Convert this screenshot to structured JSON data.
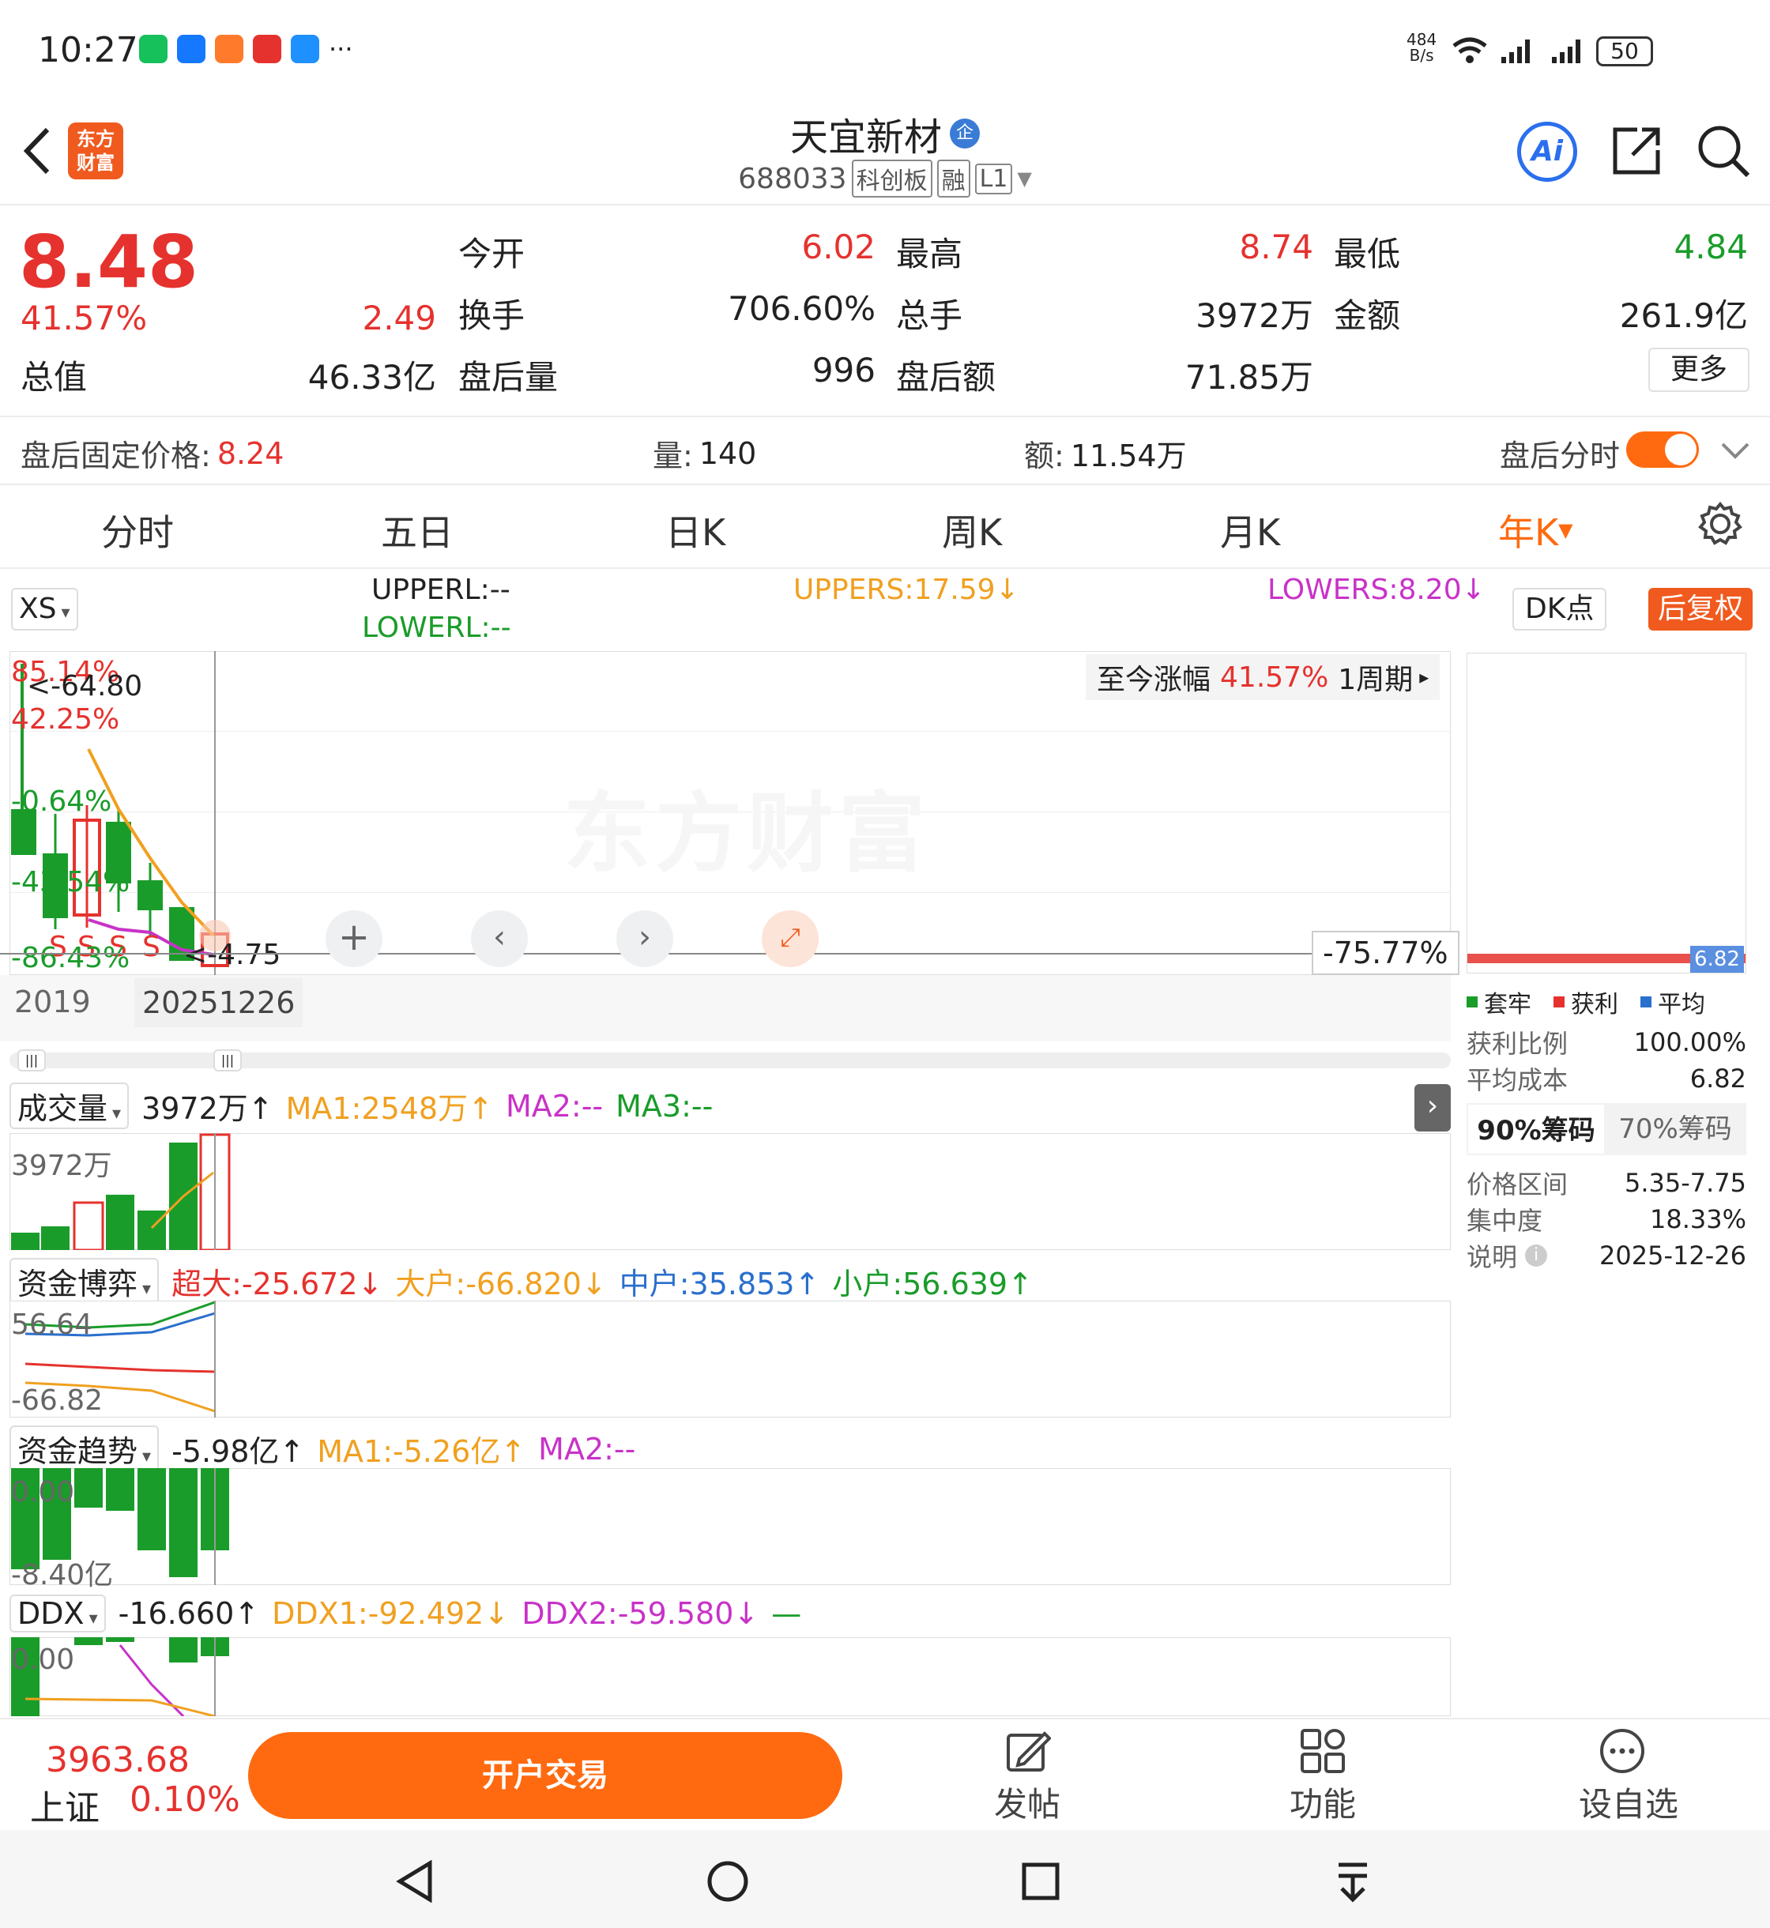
{
  "status": {
    "time": "10:27",
    "net_speed_value": "484",
    "net_speed_unit": "B/s",
    "battery": "50"
  },
  "header": {
    "name": "天宜新材",
    "enterprise_badge": "企",
    "code": "688033",
    "tags": [
      "科创板",
      "融",
      "L1"
    ],
    "brand_line1": "东方",
    "brand_line2": "财富",
    "ai_label": "Ai"
  },
  "quote": {
    "price": "8.48",
    "change_pct": "41.57%",
    "change_abs": "2.49",
    "open_label": "今开",
    "open": "6.02",
    "high_label": "最高",
    "high": "8.74",
    "low_label": "最低",
    "low": "4.84",
    "turnover_label": "换手",
    "turnover": "706.60%",
    "volume_label": "总手",
    "volume": "3972万",
    "amount_label": "金额",
    "amount": "261.9亿",
    "mktcap_label": "总值",
    "mktcap": "46.33亿",
    "after_vol_label": "盘后量",
    "after_vol": "996",
    "after_amt_label": "盘后额",
    "after_amt": "71.85万",
    "more": "更多"
  },
  "after_hours": {
    "price_label": "盘后固定价格:",
    "price": "8.24",
    "vol_label": "量:",
    "vol": "140",
    "amt_label": "额:",
    "amt": "11.54万",
    "toggle_label": "盘后分时"
  },
  "tabs": [
    "分时",
    "五日",
    "日K",
    "周K",
    "月K",
    "年K"
  ],
  "indicator": {
    "name": "XS",
    "upperl": "UPPERL:--",
    "lowerl": "LOWERL:--",
    "uppers": "UPPERS:17.59↓",
    "lowers": "LOWERS:8.20↓",
    "dk": "DK点",
    "fq": "后复权"
  },
  "chart": {
    "range_label": "至今涨幅",
    "range_value": "41.57%",
    "period": "1周期",
    "y_labels": [
      "85.14%",
      "42.25%",
      "-0.64%",
      "-43.54%",
      "-86.43%"
    ],
    "hi_marker": "<-64.80",
    "lo_marker": "<-4.75",
    "cross_value": "-75.77%",
    "x_start": "2019",
    "x_end": "20251226",
    "watermark": "东方财富"
  },
  "chip": {
    "avg_tag": "6.82",
    "legend": [
      "套牢",
      "获利",
      "平均"
    ],
    "rows": [
      {
        "k": "获利比例",
        "v": "100.00%"
      },
      {
        "k": "平均成本",
        "v": "6.82"
      }
    ],
    "tab_a": "90%筹码",
    "tab_b": "70%筹码",
    "rows2": [
      {
        "k": "价格区间",
        "v": "5.35-7.75"
      },
      {
        "k": "集中度",
        "v": "18.33%"
      },
      {
        "k": "说明",
        "v": "2025-12-26"
      }
    ]
  },
  "volume_panel": {
    "name": "成交量",
    "value": "3972万↑",
    "ma1": "MA1:2548万↑",
    "ma2": "MA2:--",
    "ma3": "MA3:--",
    "label": "3972万"
  },
  "fund_game": {
    "name": "资金博弈",
    "super": "超大:-25.672↓",
    "big": "大户:-66.820↓",
    "mid": "中户:35.853↑",
    "small": "小户:56.639↑",
    "top": "56.64",
    "bottom": "-66.82"
  },
  "fund_trend": {
    "name": "资金趋势",
    "value": "-5.98亿↑",
    "ma1": "MA1:-5.26亿↑",
    "ma2": "MA2:--",
    "top": "0.00",
    "bottom": "-8.40亿"
  },
  "ddx": {
    "name": "DDX",
    "value": "-16.660↑",
    "ddx1": "DDX1:-92.492↓",
    "ddx2": "DDX2:-59.580↓",
    "dash": "—",
    "top": "0.00"
  },
  "bottom": {
    "index_value": "3963.68",
    "index_name": "上证",
    "index_change": "0.10%",
    "trade_btn": "开户交易",
    "post": "发帖",
    "func": "功能",
    "watch": "设自选"
  },
  "colors": {
    "up": "#e5322e",
    "down": "#1a9c2a",
    "accent": "#ff6a10"
  }
}
